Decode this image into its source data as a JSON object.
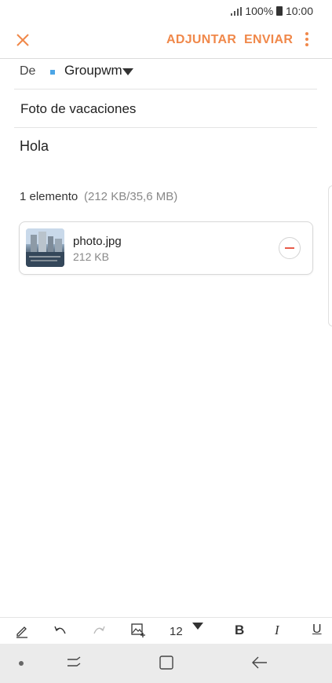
{
  "status_bar": {
    "battery": "100%",
    "time": "10:00"
  },
  "action_bar": {
    "attach_label": "ADJUNTAR",
    "send_label": "ENVIAR",
    "accent_color": "#f0884a"
  },
  "from": {
    "label": "De",
    "account": "Groupwm"
  },
  "subject": "Foto de vacaciones",
  "body": "Hola",
  "attachments": {
    "count_label": "1 elemento",
    "size_label": "(212 KB/35,6 MB)",
    "items": [
      {
        "name": "photo.jpg",
        "size": "212 KB"
      }
    ]
  },
  "toolbar": {
    "font_size": "12",
    "bold": "B",
    "italic": "I",
    "underline": "U",
    "icons": [
      "pen-icon",
      "undo-icon",
      "redo-icon",
      "insert-image-icon",
      "bold-icon",
      "italic-icon",
      "underline-icon"
    ]
  },
  "nav": {
    "icons": [
      "dot-icon",
      "recents-icon",
      "home-icon",
      "back-icon"
    ]
  }
}
